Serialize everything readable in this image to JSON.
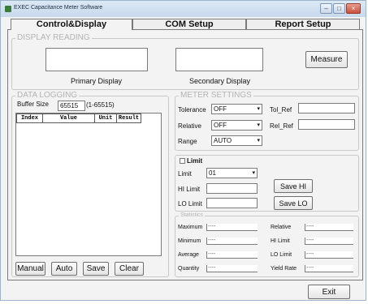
{
  "window": {
    "title": "EXEC Capacitance Meter Software",
    "min": "–",
    "max": "□",
    "close": "×"
  },
  "tabs": [
    "Control&Display",
    "COM Setup",
    "Report Setup"
  ],
  "display": {
    "legend": "DISPLAY READING",
    "primary_label": "Primary Display",
    "secondary_label": "Secondary Display",
    "primary_value": "",
    "secondary_value": "",
    "measure_button": "Measure"
  },
  "logging": {
    "legend": "DATA LOGGING",
    "buffer_label": "Buffer Size",
    "buffer_value": "65515",
    "buffer_range": "(1-65515)",
    "columns": [
      "Index",
      "Value",
      "Unit",
      "Result"
    ],
    "buttons": {
      "manual": "Manual",
      "auto": "Auto",
      "save": "Save",
      "clear": "Clear"
    }
  },
  "meter": {
    "legend": "METER SETTINGS",
    "tolerance_label": "Tolerance",
    "tolerance_value": "OFF",
    "relative_label": "Relative",
    "relative_value": "OFF",
    "range_label": "Range",
    "range_value": "AUTO",
    "tol_ref_label": "Tol_Ref",
    "tol_ref_value": "",
    "rel_ref_label": "Rel_Ref",
    "rel_ref_value": ""
  },
  "limit": {
    "checkbox_label": "Limit",
    "checked": false,
    "limit_label": "Limit",
    "limit_value": "01",
    "hi_label": "HI Limit",
    "hi_value": "",
    "lo_label": "LO Limit",
    "lo_value": "",
    "save_hi": "Save HI",
    "save_lo": "Save LO"
  },
  "statistics": {
    "legend": "Statistics",
    "left": [
      {
        "label": "Maximum",
        "value": "----"
      },
      {
        "label": "Minimum",
        "value": "----"
      },
      {
        "label": "Average",
        "value": "----"
      },
      {
        "label": "Quantity",
        "value": "----"
      }
    ],
    "right": [
      {
        "label": "Relative",
        "value": "----"
      },
      {
        "label": "HI Limit",
        "value": "----"
      },
      {
        "label": "LO Limit",
        "value": "----"
      },
      {
        "label": "Yield Rate",
        "value": "----"
      }
    ]
  },
  "exit_button": "Exit"
}
